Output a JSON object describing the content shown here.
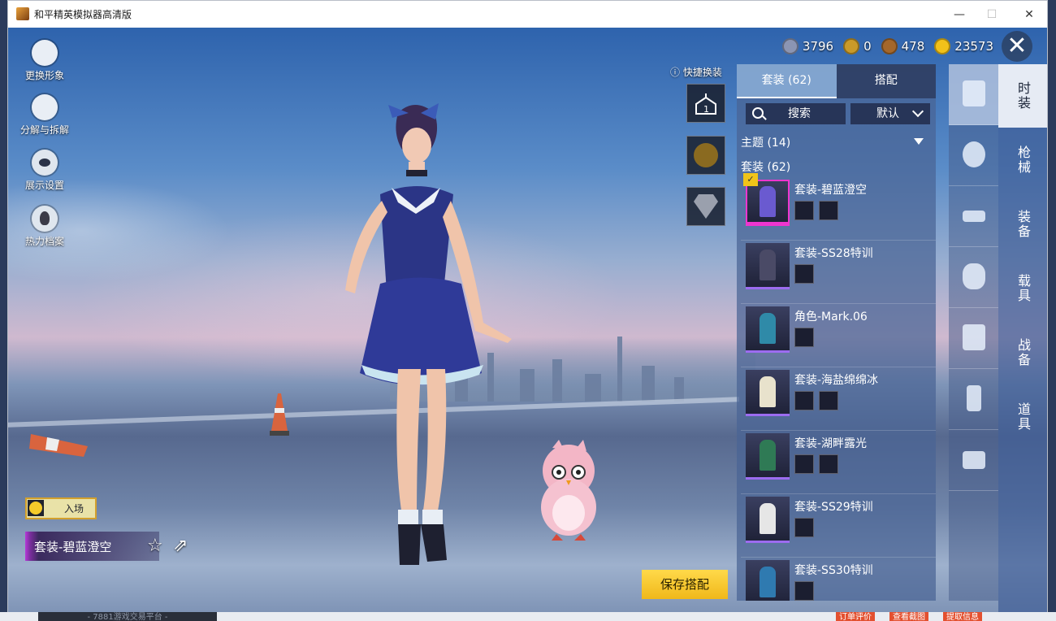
{
  "window": {
    "title": "和平精英模拟器高清版",
    "minimize": "—",
    "maximize": "☐",
    "close": "✕"
  },
  "left_menu": [
    {
      "name": "change-avatar",
      "label": "更换形象"
    },
    {
      "name": "disassemble",
      "label": "分解与拆解"
    },
    {
      "name": "display-settings",
      "label": "展示设置"
    },
    {
      "name": "heat-archive",
      "label": "热力档案"
    }
  ],
  "currencies": [
    {
      "name": "currency-1",
      "value": "3796",
      "color": "#7f8aa8"
    },
    {
      "name": "currency-2",
      "value": "0",
      "color": "#c99a2a"
    },
    {
      "name": "currency-3",
      "value": "478",
      "color": "#a4672b"
    },
    {
      "name": "currency-4",
      "value": "23573",
      "color": "#f1c11a"
    }
  ],
  "quick_change": {
    "label": "快捷换装"
  },
  "panel": {
    "tab_outfits": "套装 (62)",
    "tab_match": "搭配",
    "search": "搜索",
    "sort": "默认",
    "theme_row": "主题 (14)",
    "outfits_row": "套装 (62)",
    "items": [
      {
        "name": "套装-碧蓝澄空",
        "color": "#6a5ad0",
        "selected": true
      },
      {
        "name": "套装-SS28特训",
        "color": "#4a4a66"
      },
      {
        "name": "角色-Mark.06",
        "color": "#2f8aa8"
      },
      {
        "name": "套装-海盐绵绵冰",
        "color": "#e8e2cc"
      },
      {
        "name": "套装-湖畔露光",
        "color": "#2f7a55"
      },
      {
        "name": "套装-SS29特训",
        "color": "#e6e6e6"
      },
      {
        "name": "套装-SS30特训",
        "color": "#2f7ab0"
      }
    ]
  },
  "right_tabs": [
    "时装",
    "枪械",
    "装备",
    "载具",
    "战备",
    "道具"
  ],
  "bottom_left": {
    "entrance_label": "入场",
    "outfit_name": "套装-碧蓝澄空"
  },
  "save_button": "保存搭配",
  "desktop_strip": {
    "left_text": "- 7881游戏交易平台 -",
    "btn1": "订单评价",
    "btn2": "查看截图",
    "btn3": "提取信息"
  }
}
